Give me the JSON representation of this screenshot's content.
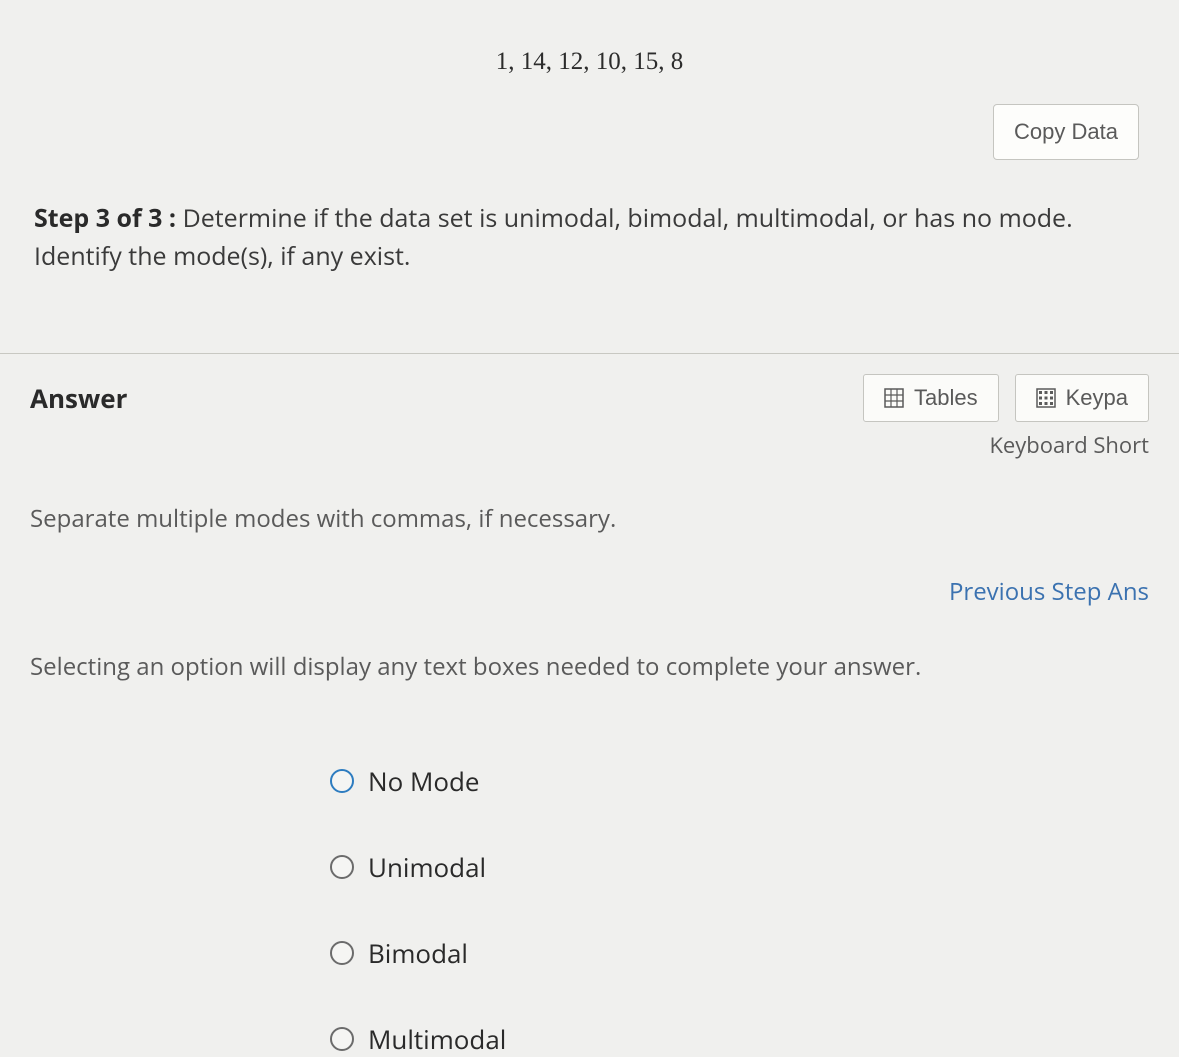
{
  "data_list": "1, 14, 12, 10, 15, 8",
  "copy_button": "Copy Data",
  "step": {
    "label": "Step 3 of 3 :",
    "text": "Determine if the data set is unimodal, bimodal, multimodal, or has no mode. Identify the mode(s), if any exist."
  },
  "answer": {
    "title": "Answer",
    "tables_btn": "Tables",
    "keypad_btn": "Keypa",
    "keyboard_short": "Keyboard Short",
    "hint": "Separate multiple modes with commas, if necessary.",
    "prev_step": "Previous Step Ans",
    "select_hint": "Selecting an option will display any text boxes needed to complete your answer."
  },
  "options": [
    {
      "label": "No Mode"
    },
    {
      "label": "Unimodal"
    },
    {
      "label": "Bimodal"
    },
    {
      "label": "Multimodal"
    }
  ]
}
